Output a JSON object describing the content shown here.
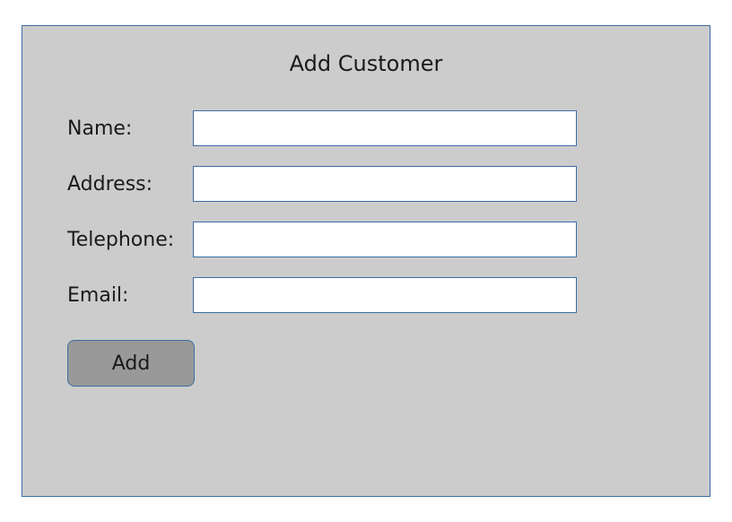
{
  "form": {
    "title": "Add Customer",
    "fields": {
      "name": {
        "label": "Name:",
        "value": ""
      },
      "address": {
        "label": "Address:",
        "value": ""
      },
      "telephone": {
        "label": "Telephone:",
        "value": ""
      },
      "email": {
        "label": "Email:",
        "value": ""
      }
    },
    "submit_label": "Add"
  }
}
